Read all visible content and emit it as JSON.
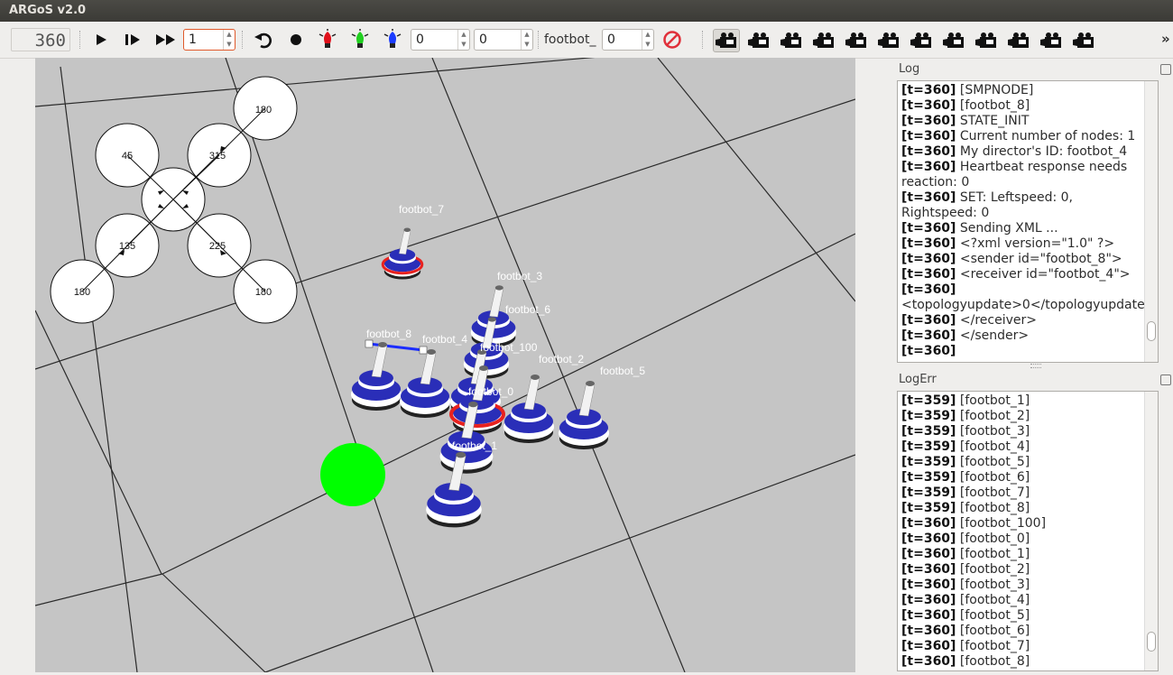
{
  "window": {
    "title": "ARGoS v2.0"
  },
  "toolbar": {
    "step_counter": "360",
    "play_icon": "play-icon",
    "step_icon": "step-icon",
    "fast_forward_icon": "fast-forward-icon",
    "speed_value": "1",
    "reset_icon": "reset-icon",
    "record_icon": "record-icon",
    "red_light_icon": "red-light-icon",
    "green_light_icon": "green-light-icon",
    "blue_light_icon": "blue-light-icon",
    "field_a_value": "0",
    "field_b_value": "0",
    "footbot_label": "footbot_",
    "footbot_value": "0",
    "stop_icon": "stop-icon",
    "more_label": "»"
  },
  "compass": {
    "top_right": "180",
    "upper_left": "45",
    "upper_right": "315",
    "lower_left": "135",
    "lower_right": "225",
    "bottom_left": "180",
    "bottom_right": "180"
  },
  "robots": {
    "footbot_7": "footbot_7",
    "footbot_3": "footbot_3",
    "footbot_6": "footbot_6",
    "footbot_100": "footbot_100",
    "footbot_8": "footbot_8",
    "footbot_4": "footbot_4",
    "footbot_2": "footbot_2",
    "footbot_5": "footbot_5",
    "footbot_0": "footbot_0",
    "footbot_1": "footbot_1"
  },
  "log": {
    "title": "Log",
    "lines": [
      {
        "t": "[t=360]",
        "msg": " [SMPNODE]"
      },
      {
        "t": "[t=360]",
        "msg": " [footbot_8]"
      },
      {
        "t": "[t=360]",
        "msg": " STATE_INIT"
      },
      {
        "t": "[t=360]",
        "msg": " Current number of nodes: 1"
      },
      {
        "t": "[t=360]",
        "msg": " My director's ID: footbot_4"
      },
      {
        "t": "[t=360]",
        "msg": " Heartbeat response needs"
      },
      {
        "t": "",
        "msg": "reaction: 0"
      },
      {
        "t": "[t=360]",
        "msg": " SET: Leftspeed: 0, Rightspeed: 0"
      },
      {
        "t": "[t=360]",
        "msg": " Sending XML ..."
      },
      {
        "t": "[t=360]",
        "msg": " <?xml version=\"1.0\" ?>"
      },
      {
        "t": "[t=360]",
        "msg": " <sender id=\"footbot_8\">"
      },
      {
        "t": "[t=360]",
        "msg": " <receiver id=\"footbot_4\">"
      },
      {
        "t": "[t=360]",
        "msg": ""
      },
      {
        "t": "",
        "msg": "<topologyupdate>0</topologyupdate>"
      },
      {
        "t": "[t=360]",
        "msg": " </receiver>"
      },
      {
        "t": "[t=360]",
        "msg": " </sender>"
      },
      {
        "t": "[t=360]",
        "msg": ""
      }
    ]
  },
  "logerr": {
    "title": "LogErr",
    "lines": [
      {
        "t": "[t=359]",
        "msg": " [footbot_1]"
      },
      {
        "t": "[t=359]",
        "msg": " [footbot_2]"
      },
      {
        "t": "[t=359]",
        "msg": " [footbot_3]"
      },
      {
        "t": "[t=359]",
        "msg": " [footbot_4]"
      },
      {
        "t": "[t=359]",
        "msg": " [footbot_5]"
      },
      {
        "t": "[t=359]",
        "msg": " [footbot_6]"
      },
      {
        "t": "[t=359]",
        "msg": " [footbot_7]"
      },
      {
        "t": "[t=359]",
        "msg": " [footbot_8]"
      },
      {
        "t": "[t=360]",
        "msg": " [footbot_100]"
      },
      {
        "t": "[t=360]",
        "msg": " [footbot_0]"
      },
      {
        "t": "[t=360]",
        "msg": " [footbot_1]"
      },
      {
        "t": "[t=360]",
        "msg": " [footbot_2]"
      },
      {
        "t": "[t=360]",
        "msg": " [footbot_3]"
      },
      {
        "t": "[t=360]",
        "msg": " [footbot_4]"
      },
      {
        "t": "[t=360]",
        "msg": " [footbot_5]"
      },
      {
        "t": "[t=360]",
        "msg": " [footbot_6]"
      },
      {
        "t": "[t=360]",
        "msg": " [footbot_7]"
      },
      {
        "t": "[t=360]",
        "msg": " [footbot_8]"
      }
    ]
  },
  "colors": {
    "led_red": "#e8221f",
    "led_green": "#00ff00",
    "robot_blue": "#2a2eb8",
    "link_blue": "#1a2cff"
  }
}
